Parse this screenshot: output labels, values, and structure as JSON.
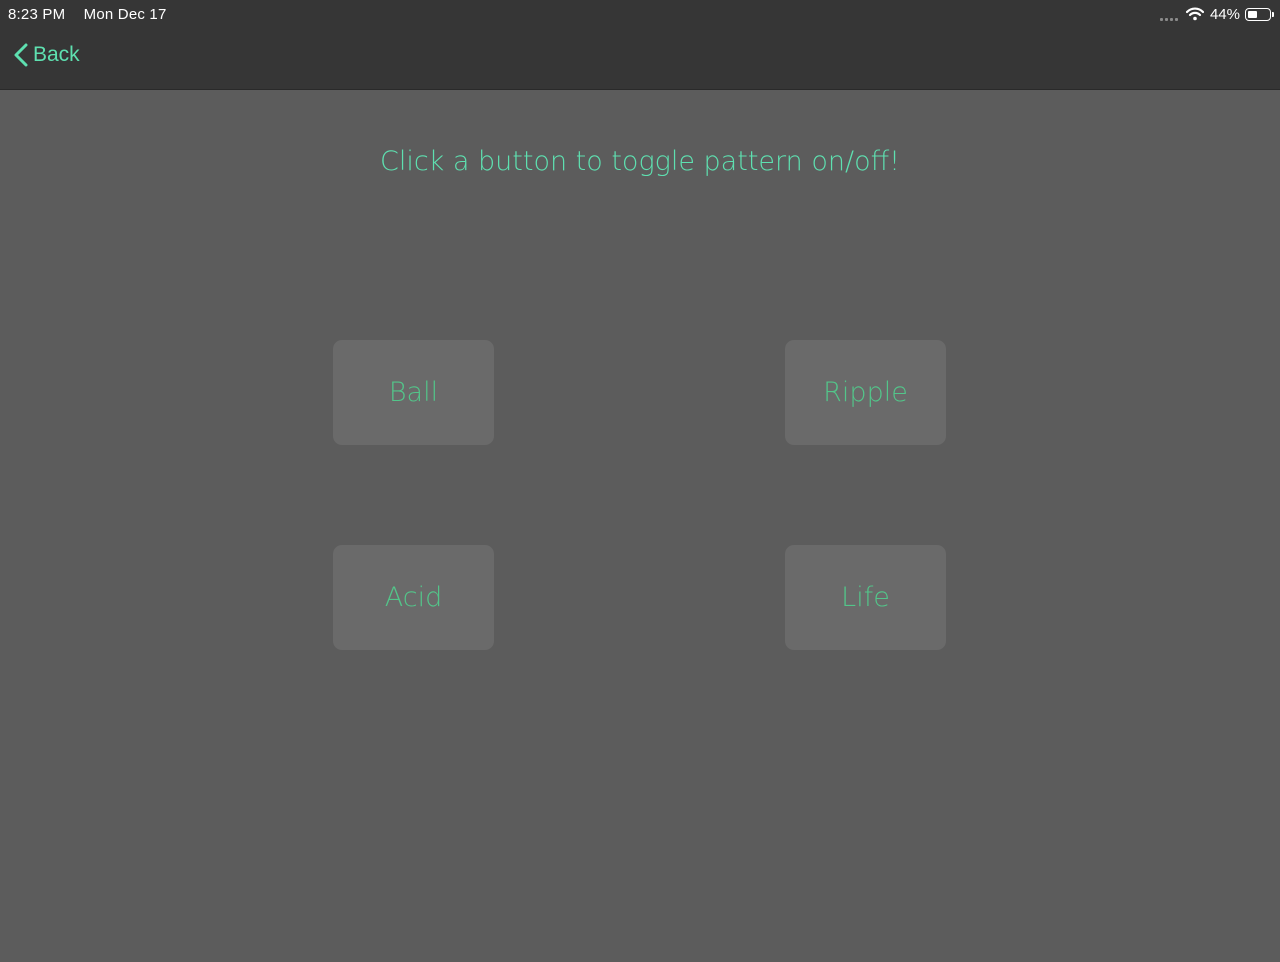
{
  "status_bar": {
    "time": "8:23 PM",
    "date": "Mon Dec 17",
    "battery_percent": "44%",
    "battery_level": 0.44,
    "icons": [
      "cellular-signal-icon",
      "wifi-icon",
      "battery-icon"
    ]
  },
  "nav": {
    "back_label": "Back"
  },
  "main": {
    "instruction": "Click a button to toggle pattern on/off!",
    "buttons": [
      {
        "label": "Ball"
      },
      {
        "label": "Ripple"
      },
      {
        "label": "Acid"
      },
      {
        "label": "Life"
      }
    ]
  },
  "colors": {
    "accent": "#5ee0b0",
    "button_text": "#53c58a",
    "background": "#5c5c5c",
    "nav_bar": "#363636",
    "button_bg": "#6a6a6a"
  }
}
